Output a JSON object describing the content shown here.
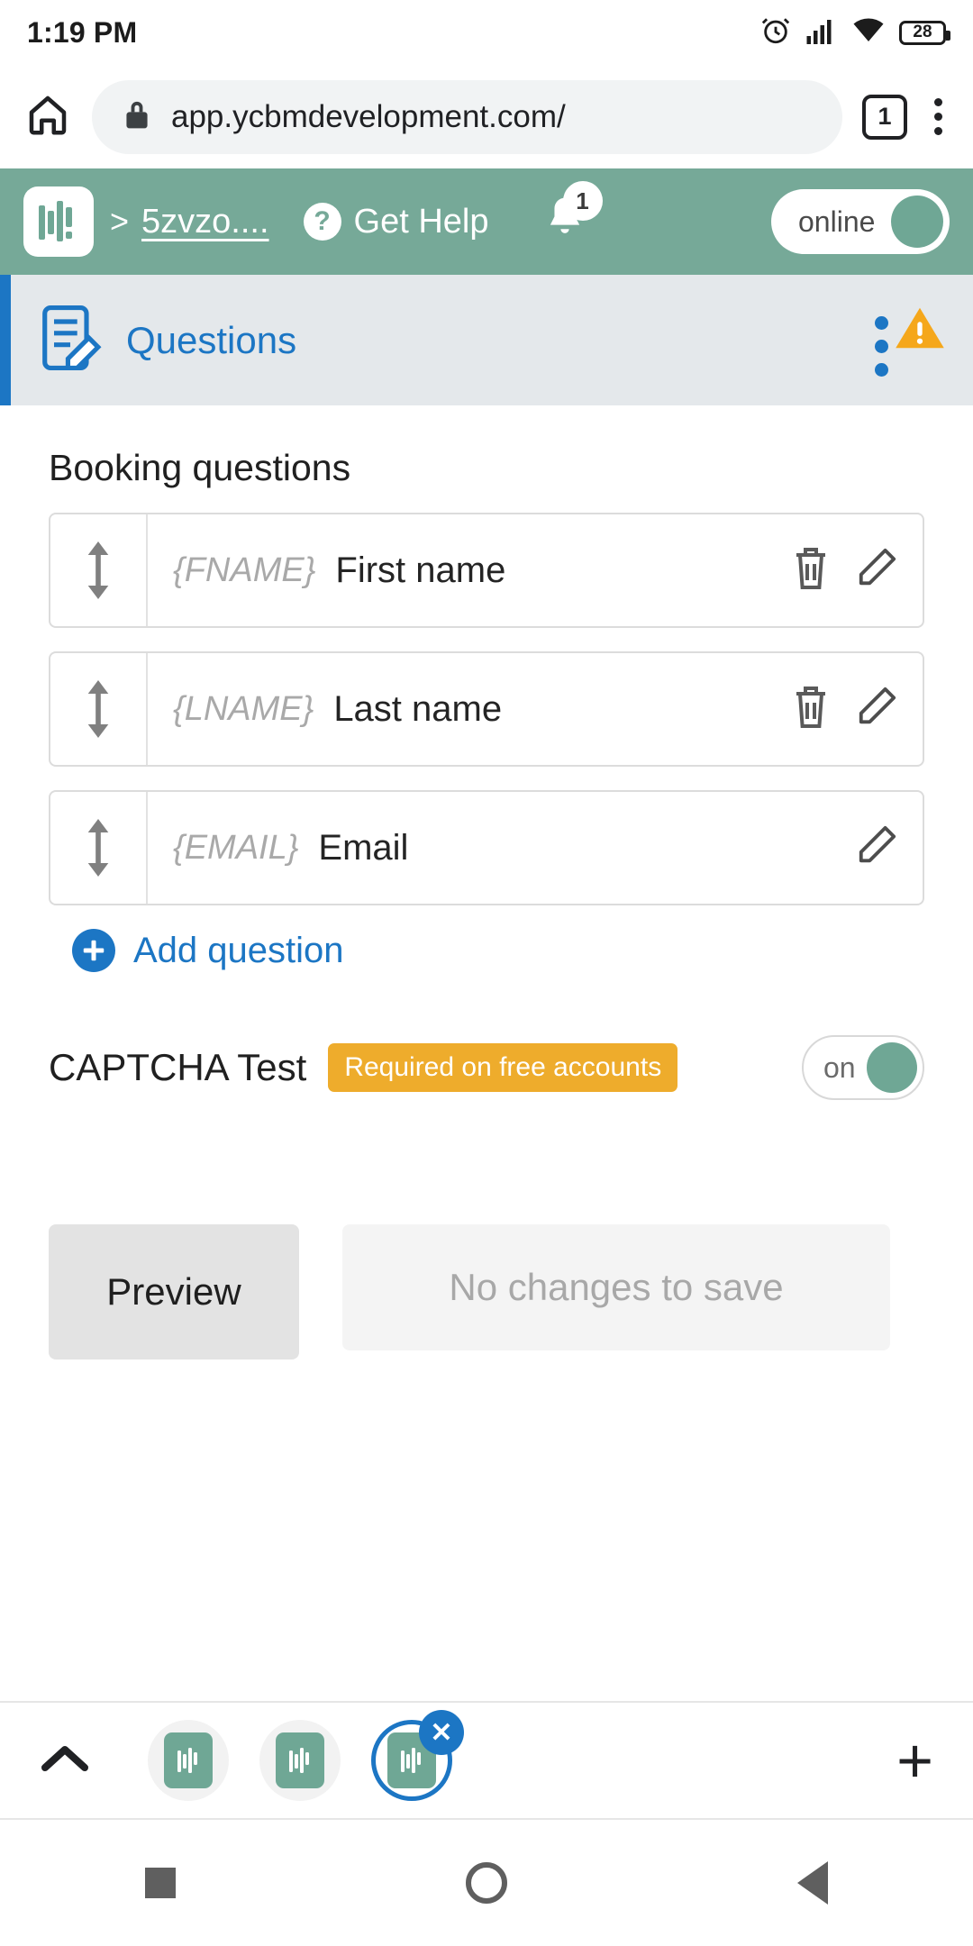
{
  "status_bar": {
    "time": "1:19 PM",
    "battery_level": "28",
    "icons": [
      "alarm-icon",
      "cellular-signal-icon",
      "wifi-icon",
      "battery-icon"
    ]
  },
  "browser": {
    "home_icon": "home-icon",
    "lock_icon": "lock-icon",
    "url": "app.ycbmdevelopment.com/",
    "tab_count": "1",
    "menu_icon": "kebab-menu-icon"
  },
  "app_header": {
    "logo": "ycbm-bar-logo",
    "breadcrumb_separator": ">",
    "breadcrumb": "5zvzo....",
    "help_icon": "question-mark-icon",
    "help_label": "Get Help",
    "bell_icon": "bell-icon",
    "notification_count": "1",
    "status_toggle_label": "online",
    "status_toggle_on": true,
    "background_color": "#76a998"
  },
  "section_header": {
    "icon": "form-edit-icon",
    "title": "Questions",
    "menu_icon": "kebab-menu-icon",
    "warning_icon": "warning-triangle-icon",
    "accent_color": "#1c76c4",
    "warning_color": "#f5a71b",
    "background_color": "#e4e8eb"
  },
  "main": {
    "section_title": "Booking questions",
    "questions": [
      {
        "drag_handle": "drag-updown-icon",
        "token": "{FNAME}",
        "name": "First name",
        "has_delete": true,
        "delete_icon": "trash-icon",
        "edit_icon": "pencil-icon"
      },
      {
        "drag_handle": "drag-updown-icon",
        "token": "{LNAME}",
        "name": "Last name",
        "has_delete": true,
        "delete_icon": "trash-icon",
        "edit_icon": "pencil-icon"
      },
      {
        "drag_handle": "drag-updown-icon",
        "token": "{EMAIL}",
        "name": "Email",
        "has_delete": false,
        "delete_icon": "",
        "edit_icon": "pencil-icon"
      }
    ],
    "add_question": {
      "icon": "plus-circle-icon",
      "label": "Add question"
    },
    "captcha": {
      "label": "CAPTCHA Test",
      "badge": "Required on free accounts",
      "badge_color": "#eeac2c",
      "toggle_label": "on",
      "toggle_on": true
    },
    "buttons": {
      "preview": "Preview",
      "save": "No changes to save",
      "save_disabled": true
    }
  },
  "tab_bar": {
    "collapse_icon": "chevron-up-icon",
    "tabs": [
      {
        "icon": "ycbm-app-icon",
        "active": false
      },
      {
        "icon": "ycbm-app-icon",
        "active": false
      },
      {
        "icon": "ycbm-app-icon",
        "active": true,
        "close_icon": "close-x-icon",
        "close_label": "✕"
      }
    ],
    "add_icon": "plus-icon",
    "add_label": "+"
  },
  "nav_bar": {
    "recents": "square-icon",
    "home": "circle-icon",
    "back": "triangle-back-icon"
  }
}
